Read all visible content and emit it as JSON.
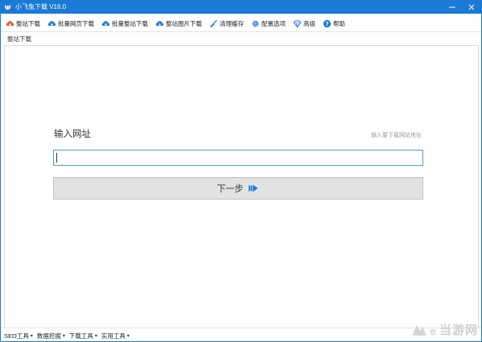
{
  "window": {
    "title": "小飞兔下载 V16.0",
    "controls": [
      "minimize",
      "close"
    ]
  },
  "toolbar": {
    "items": [
      {
        "label": "整站下载",
        "icon": "cloud-download-icon",
        "color": "#e8542a"
      },
      {
        "label": "批量网页下载",
        "icon": "cloud-download-icon",
        "color": "#1a7ad6"
      },
      {
        "label": "批量整站下载",
        "icon": "cloud-download-icon",
        "color": "#1a7ad6"
      },
      {
        "label": "整站图片下载",
        "icon": "cloud-download-icon",
        "color": "#1a7ad6"
      },
      {
        "label": "清理缓存",
        "icon": "broom-icon",
        "color": "#1a7ad6"
      },
      {
        "label": "配置选项",
        "icon": "gear-icon",
        "color": "#1a7ad6"
      },
      {
        "label": "高级",
        "icon": "diamond-icon",
        "color": "#1a7ad6"
      },
      {
        "label": "帮助",
        "icon": "help-icon",
        "color": "#1a7ad6"
      }
    ]
  },
  "tab": {
    "label": "整站下载"
  },
  "form": {
    "title": "输入网址",
    "hint": "输入要下载网站地址",
    "url_value": "",
    "next_label": "下一步"
  },
  "bottombar": {
    "items": [
      {
        "label": "SEO工具"
      },
      {
        "label": "数据挖掘"
      },
      {
        "label": "下载工具"
      },
      {
        "label": "实用工具"
      }
    ]
  },
  "watermark": {
    "text": "当游网"
  },
  "colors": {
    "accent": "#1a7ad6",
    "button_bg": "#e2e2e2",
    "input_border": "#4a9bd9"
  }
}
